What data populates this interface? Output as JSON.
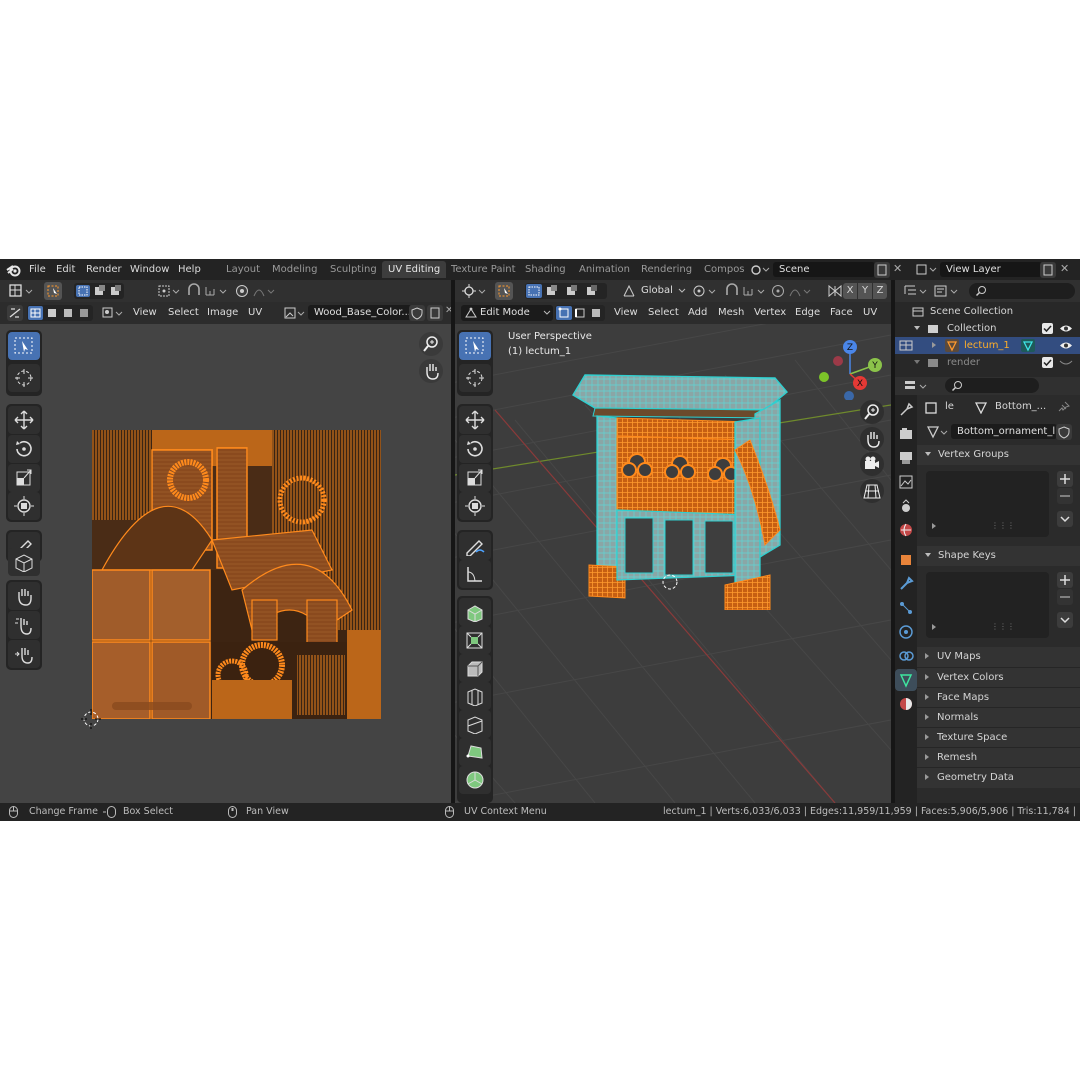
{
  "topbar": {
    "menus": [
      "File",
      "Edit",
      "Render",
      "Window",
      "Help"
    ],
    "workspaces": [
      "Layout",
      "Modeling",
      "Sculpting",
      "UV Editing",
      "Texture Paint",
      "Shading",
      "Animation",
      "Rendering",
      "Compos"
    ],
    "active_workspace": "UV Editing",
    "scene": "Scene",
    "view_layer": "View Layer"
  },
  "uv_editor": {
    "menus": [
      "View",
      "Select",
      "Image",
      "UV"
    ],
    "image_name": "Wood_Base_Color...."
  },
  "viewport": {
    "mode": "Edit Mode",
    "transform_orientation": "Global",
    "axes": [
      "X",
      "Y",
      "Z"
    ],
    "menus": [
      "View",
      "Select",
      "Add",
      "Mesh",
      "Vertex",
      "Edge",
      "Face",
      "UV"
    ],
    "overlay_title": "User Perspective",
    "overlay_object": "(1) lectum_1",
    "gizmo": {
      "z": "Z",
      "y": "Y",
      "x": "X"
    }
  },
  "outliner": {
    "scene_collection": "Scene Collection",
    "collection": "Collection",
    "object": "lectum_1",
    "render": "render"
  },
  "properties": {
    "object_short": "le",
    "mesh_short": "Bottom_...",
    "mesh_name": "Bottom_ornament_l...",
    "panels_open": [
      "Vertex Groups",
      "Shape Keys"
    ],
    "panels_closed": [
      "UV Maps",
      "Vertex Colors",
      "Face Maps",
      "Normals",
      "Texture Space",
      "Remesh",
      "Geometry Data"
    ]
  },
  "statusbar": {
    "change_frame": "Change Frame",
    "box_select": "Box Select",
    "pan_view": "Pan View",
    "uv_context": "UV Context Menu",
    "stats": "lectum_1 | Verts:6,033/6,033 | Edges:11,959/11,959 | Faces:5,906/5,906 | Tris:11,784 |"
  },
  "colors": {
    "accent": "#4772b3",
    "selected": "#ff8a1c",
    "teal": "#2fd0d0"
  }
}
